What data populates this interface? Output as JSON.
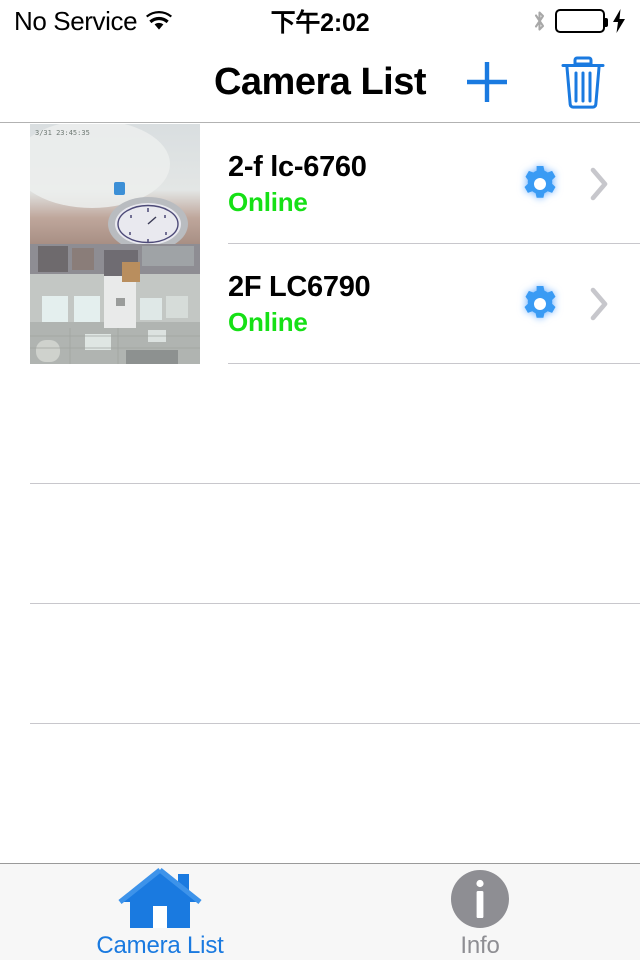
{
  "status_bar": {
    "carrier": "No Service",
    "time": "下午2:02",
    "wifi_icon": "wifi-icon",
    "bluetooth_icon": "bluetooth-icon",
    "battery_icon": "battery-charging-icon",
    "battery_color": "#44db5e",
    "charging_icon": "lightning-bolt-icon"
  },
  "nav_bar": {
    "title": "Camera List",
    "add_label": "+",
    "add_icon": "plus-icon",
    "delete_icon": "trash-icon",
    "tint_color": "#1a7ae0"
  },
  "list": {
    "status_online_color": "#16e016",
    "rows": [
      {
        "name": "2-f lc-6760",
        "status": "Online",
        "thumbnail_timestamp": "3/31 23:45:35",
        "settings_icon": "gear-icon",
        "disclosure_icon": "chevron-right-icon"
      },
      {
        "name": "2F LC6790",
        "status": "Online",
        "thumbnail_timestamp": "",
        "settings_icon": "gear-icon",
        "disclosure_icon": "chevron-right-icon"
      }
    ],
    "empty_row_count": 3
  },
  "tab_bar": {
    "active_color": "#1a7ae0",
    "inactive_color": "#8e8e93",
    "tabs": [
      {
        "label": "Camera List",
        "icon": "home-icon",
        "active": true
      },
      {
        "label": "Info",
        "icon": "info-circle-icon",
        "active": false
      }
    ]
  }
}
